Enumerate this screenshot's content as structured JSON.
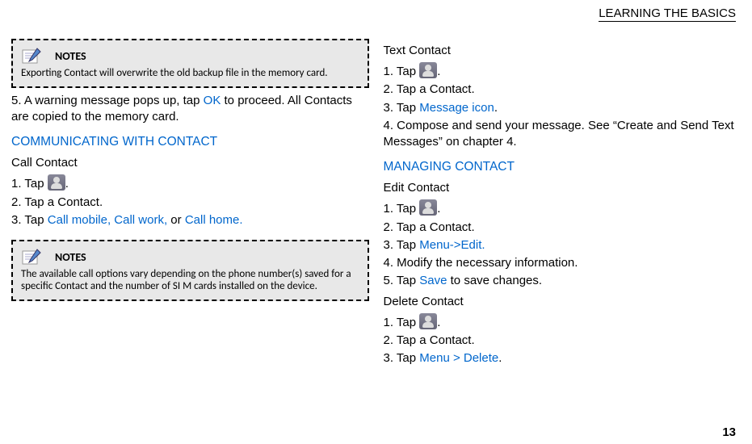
{
  "header": "LEARNING THE BASICS",
  "page_number": "13",
  "left": {
    "note1": {
      "title": "NOTES",
      "body": "Exporting Contact will overwrite the old backup file in the memory card."
    },
    "step5_a": "5. A warning message pops up, tap ",
    "step5_link": "OK",
    "step5_b": " to proceed. All Contacts are copied to the memory card.",
    "heading_comm": "COMMUNICATING WITH CONTACT",
    "call_contact": "Call Contact",
    "cc_s1_a": "1. Tap ",
    "cc_s1_b": ".",
    "cc_s2": "2. Tap a Contact.",
    "cc_s3_a": "3. Tap ",
    "cc_s3_link1": "Call mobile, Call work,",
    "cc_s3_mid": " or ",
    "cc_s3_link2": "Call home.",
    "note2": {
      "title": "NOTES",
      "body": "The available call options vary depending on the phone number(s) saved for a specific Contact and the number of SI M cards installed on the device."
    }
  },
  "right": {
    "text_contact": "Text Contact",
    "tc_s1_a": "1. Tap ",
    "tc_s1_b": ".",
    "tc_s2": "2. Tap a Contact.",
    "tc_s3_a": "3. Tap ",
    "tc_s3_link": "Message icon",
    "tc_s3_b": ".",
    "tc_s4": "4. Compose and send your message. See “Create and Send Text Messages” on chapter 4.",
    "heading_manage": "MANAGING CONTACT",
    "edit_contact": "Edit Contact",
    "ec_s1_a": "1. Tap ",
    "ec_s1_b": ".",
    "ec_s2": "2. Tap a Contact.",
    "ec_s3_a": "3. Tap ",
    "ec_s3_link": "Menu->Edit.",
    "ec_s4": "4. Modify the necessary information.",
    "ec_s5_a": "5. Tap ",
    "ec_s5_link": "Save",
    "ec_s5_b": " to save changes.",
    "delete_contact": "Delete Contact",
    "dc_s1_a": "1. Tap ",
    "dc_s1_b": ".",
    "dc_s2": "2. Tap a Contact.",
    "dc_s3_a": "3. Tap ",
    "dc_s3_link": "Menu > Delete",
    "dc_s3_b": "."
  }
}
